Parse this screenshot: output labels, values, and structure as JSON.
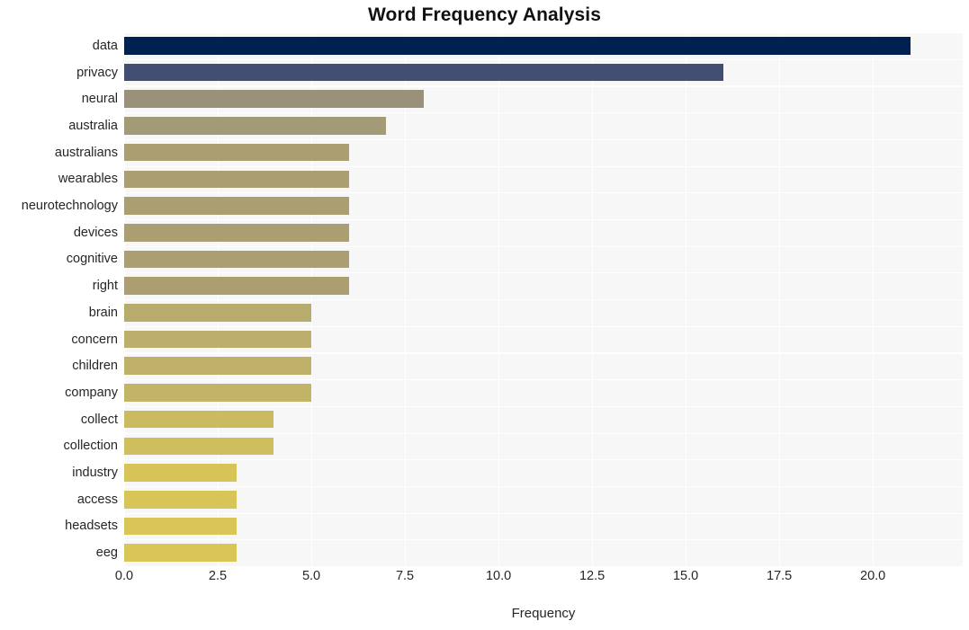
{
  "chart_data": {
    "type": "bar",
    "orientation": "horizontal",
    "title": "Word Frequency Analysis",
    "xlabel": "Frequency",
    "ylabel": "",
    "categories": [
      "data",
      "privacy",
      "neural",
      "australia",
      "australians",
      "wearables",
      "neurotechnology",
      "devices",
      "cognitive",
      "right",
      "brain",
      "concern",
      "children",
      "company",
      "collect",
      "collection",
      "industry",
      "access",
      "headsets",
      "eeg"
    ],
    "values": [
      21,
      16,
      8,
      7,
      6,
      6,
      6,
      6,
      6,
      6,
      5,
      5,
      5,
      5,
      4,
      4,
      3,
      3,
      3,
      3
    ],
    "bar_colors": [
      "#002150",
      "#414e72",
      "#99917a",
      "#a39a77",
      "#ab9f72",
      "#ab9f72",
      "#ab9f72",
      "#ab9f72",
      "#ab9f72",
      "#ab9f72",
      "#b8ab6e",
      "#bcae6c",
      "#bfb169",
      "#c2b467",
      "#cbbb60",
      "#cfbe5e",
      "#d6c459",
      "#d8c557",
      "#d9c656",
      "#d9c656"
    ],
    "xlim": [
      0,
      22.4
    ],
    "xticks": [
      0.0,
      2.5,
      5.0,
      7.5,
      10.0,
      12.5,
      15.0,
      17.5,
      20.0
    ],
    "xticklabels": [
      "0.0",
      "2.5",
      "5.0",
      "7.5",
      "10.0",
      "12.5",
      "15.0",
      "17.5",
      "20.0"
    ],
    "grid": true,
    "grid_color": "#ffffff",
    "plot_background": "#f7f7f7",
    "figure_background": "#ffffff",
    "legend": null,
    "legend_position": "none"
  }
}
